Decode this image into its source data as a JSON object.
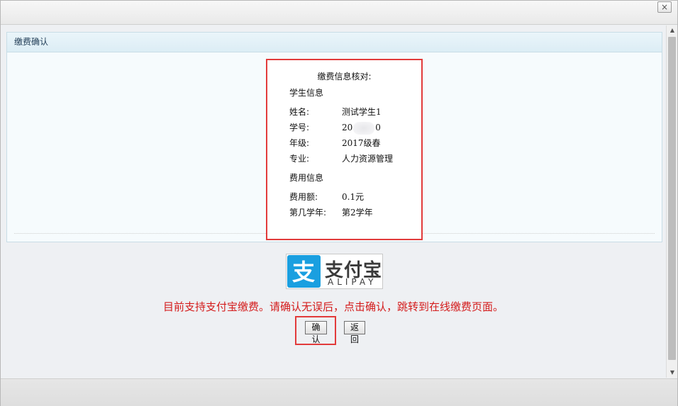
{
  "dialog": {
    "close_label": "×"
  },
  "panel": {
    "title": "缴费确认"
  },
  "verify": {
    "title": "缴费信息核对:",
    "student_section": "学生信息",
    "name_label": "姓名:",
    "name_value": "测试学生1",
    "id_label": "学号:",
    "id_value_start": "20",
    "id_value_end": "0",
    "grade_label": "年级:",
    "grade_value": "2017级春",
    "major_label": "专业:",
    "major_value": "人力资源管理",
    "fee_section": "费用信息",
    "amount_label": "费用额:",
    "amount_value": "0.1元",
    "year_label": "第几学年:",
    "year_value": "第2学年"
  },
  "alipay": {
    "name_cn": "支付宝",
    "name_en": "ALIPAY",
    "badge_char": "支",
    "brand_color": "#1a9fe0"
  },
  "notice": "目前支持支付宝缴费。请确认无误后，点击确认，跳转到在线缴费页面。",
  "buttons": {
    "confirm": "确认",
    "back": "返回"
  }
}
